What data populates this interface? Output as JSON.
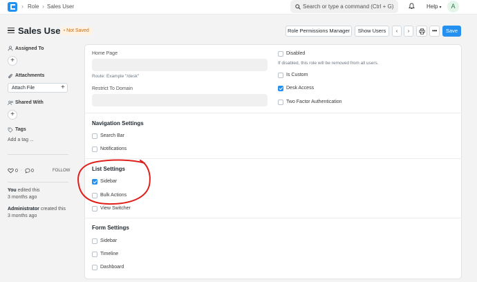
{
  "navbar": {
    "breadcrumb": [
      "Role",
      "Sales User"
    ],
    "search_placeholder": "Search or type a command (Ctrl + G)",
    "help_label": "Help",
    "avatar_initial": "A"
  },
  "header": {
    "title": "Sales User",
    "status_badge": "Not Saved",
    "buttons": {
      "role_permissions": "Role Permissions Manager",
      "show_users": "Show Users",
      "save": "Save"
    }
  },
  "sidebar": {
    "assigned_to": "Assigned To",
    "attachments": "Attachments",
    "attach_file": "Attach File",
    "shared_with": "Shared With",
    "tags": "Tags",
    "add_tag": "Add a tag ...",
    "likes": "0",
    "comments": "0",
    "follow": "FOLLOW",
    "activity": [
      {
        "who": "You",
        "what": " edited this",
        "when": "3 months ago"
      },
      {
        "who": "Administrator",
        "what": " created this",
        "when": "3 months ago"
      }
    ]
  },
  "form": {
    "home_page_label": "Home Page",
    "home_page_value": "",
    "route_hint": "Route: Example \"/desk\"",
    "restrict_domain_label": "Restrict To Domain",
    "restrict_domain_value": "",
    "disabled_label": "Disabled",
    "disabled_help": "If disabled, this role will be removed from all users.",
    "is_custom_label": "Is Custom",
    "desk_access_label": "Desk Access",
    "two_factor_label": "Two Factor Authentication",
    "checks": {
      "disabled": false,
      "is_custom": false,
      "desk_access": true,
      "two_factor": false
    }
  },
  "sections": {
    "navigation": {
      "title": "Navigation Settings",
      "items": [
        {
          "label": "Search Bar",
          "checked": false
        },
        {
          "label": "Notifications",
          "checked": false
        }
      ]
    },
    "list": {
      "title": "List Settings",
      "items": [
        {
          "label": "Sidebar",
          "checked": true
        },
        {
          "label": "Bulk Actions",
          "checked": false
        },
        {
          "label": "View Switcher",
          "checked": false
        }
      ]
    },
    "form_settings": {
      "title": "Form Settings",
      "items": [
        {
          "label": "Sidebar",
          "checked": false
        },
        {
          "label": "Timeline",
          "checked": false
        },
        {
          "label": "Dashboard",
          "checked": false
        }
      ]
    }
  },
  "colors": {
    "accent": "#2490ef",
    "annotation": "#e0201b",
    "badge_text": "#c36c1a"
  }
}
